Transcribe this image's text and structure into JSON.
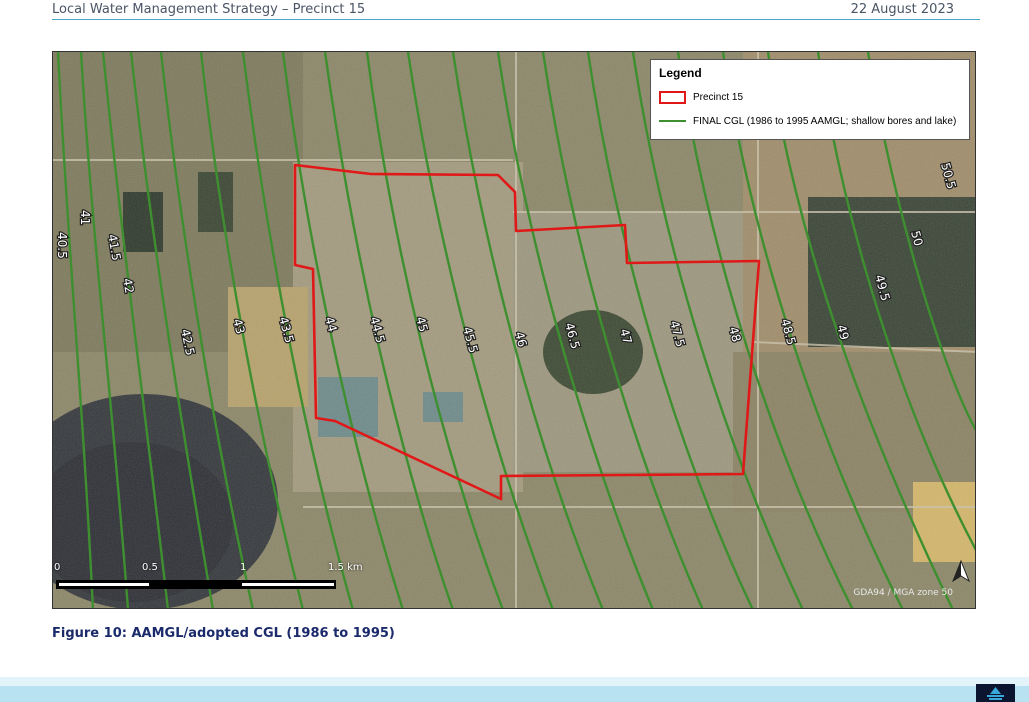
{
  "header": {
    "title": "Local Water Management Strategy – Precinct 15",
    "date": "22 August 2023"
  },
  "legend": {
    "title": "Legend",
    "items": [
      {
        "label": "Precinct 15",
        "color": "#e01818",
        "symbol": "polygon"
      },
      {
        "label": "FINAL CGL (1986 to 1995 AAMGL; shallow bores and lake)",
        "color": "#3e8f2f",
        "symbol": "line"
      }
    ]
  },
  "contours": [
    "40.5",
    "41",
    "41.5",
    "42",
    "42.5",
    "43",
    "43.5",
    "44",
    "44.5",
    "45",
    "45.5",
    "46",
    "46.5",
    "47",
    "47.5",
    "48",
    "48.5",
    "49",
    "49.5",
    "50",
    "50.5"
  ],
  "scale_bar": {
    "labels": [
      "0",
      "0.5",
      "1",
      "1.5 km"
    ]
  },
  "crs": "GDA94 / MGA zone 50",
  "caption": "Figure 10: AAMGL/adopted CGL (1986 to 1995)",
  "colors": {
    "boundary": "#e01818",
    "contour": "#3e8f2f",
    "header_rule": "#4aa3c8",
    "caption": "#1b2a6b"
  }
}
